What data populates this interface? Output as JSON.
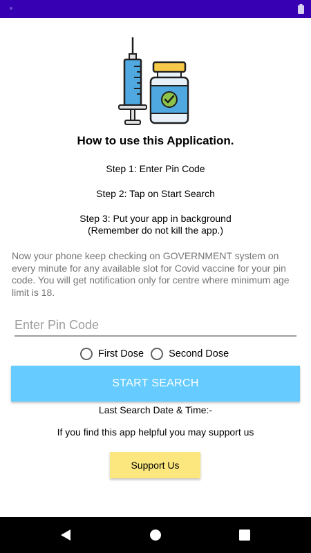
{
  "app": {
    "title": "How to use this Application.",
    "steps": [
      "Step 1: Enter Pin Code",
      "Step 2: Tap on Start Search",
      "Step 3: Put your app in background",
      "(Remember do not kill the app.)"
    ],
    "description": "Now your phone keep checking on GOVERNMENT system on every minute for any available slot for Covid vaccine for your pin code. You will get notification only for centre where minimum age limit is 18."
  },
  "form": {
    "pin_placeholder": "Enter Pin Code",
    "pin_value": "",
    "dose_options": [
      "First Dose",
      "Second Dose"
    ],
    "start_button": "START SEARCH",
    "last_search_label": "Last Search Date & Time:-"
  },
  "support": {
    "text": "If you find this app helpful you may support us",
    "button": "Support Us"
  },
  "icons": {
    "hero": "syringe-vaccine-vial-icon",
    "status": "battery-icon",
    "nav": [
      "back-icon",
      "home-icon",
      "recents-icon"
    ]
  },
  "colors": {
    "status_bar": "#3700B3",
    "start_button": "#66CCFF",
    "support_button": "#FBE77E",
    "nav_bar": "#000000"
  }
}
